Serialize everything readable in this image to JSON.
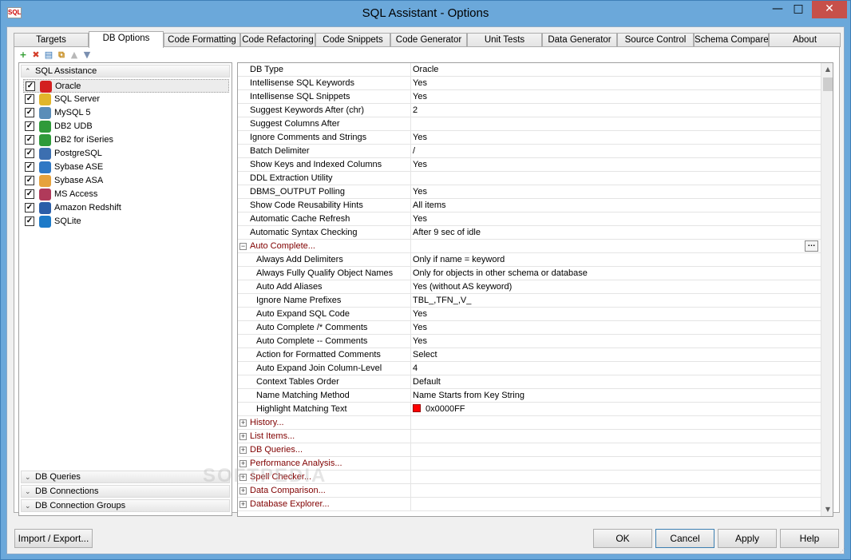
{
  "window": {
    "title": "SQL Assistant - Options",
    "icon_text": "SQL",
    "min": "—",
    "max": "□",
    "close": "✕"
  },
  "tabs": [
    "Targets",
    "DB Options",
    "Code Formatting",
    "Code Refactoring",
    "Code Snippets",
    "Code Generator",
    "Unit Tests",
    "Data Generator",
    "Source Control",
    "Schema Compare",
    "About"
  ],
  "active_tab": "DB Options",
  "toolbar": {
    "icons": [
      "add-icon",
      "delete-icon",
      "rename-icon",
      "copy-icon",
      "move-up-icon",
      "move-down-icon"
    ]
  },
  "left_panel": {
    "sql_assistance": "SQL Assistance",
    "databases": [
      {
        "label": "Oracle",
        "checked": true,
        "icon": "oracle-icon",
        "color": "#d32020"
      },
      {
        "label": "SQL Server",
        "checked": true,
        "icon": "sqlserver-icon",
        "color": "#e2b62a"
      },
      {
        "label": "MySQL 5",
        "checked": true,
        "icon": "mysql-icon",
        "color": "#5b8db8"
      },
      {
        "label": "DB2 UDB",
        "checked": true,
        "icon": "db2-icon",
        "color": "#2f9a3a"
      },
      {
        "label": "DB2 for iSeries",
        "checked": true,
        "icon": "db2-iseries-icon",
        "color": "#2f9a3a"
      },
      {
        "label": "PostgreSQL",
        "checked": true,
        "icon": "postgresql-icon",
        "color": "#3c6fb0"
      },
      {
        "label": "Sybase ASE",
        "checked": true,
        "icon": "sybase-ase-icon",
        "color": "#2f78c4"
      },
      {
        "label": "Sybase ASA",
        "checked": true,
        "icon": "sybase-asa-icon",
        "color": "#e6a23c"
      },
      {
        "label": "MS Access",
        "checked": true,
        "icon": "msaccess-icon",
        "color": "#b03a5a"
      },
      {
        "label": "Amazon Redshift",
        "checked": true,
        "icon": "redshift-icon",
        "color": "#2b5ea8"
      },
      {
        "label": "SQLite",
        "checked": true,
        "icon": "sqlite-icon",
        "color": "#1d7ac8"
      }
    ],
    "db_queries": "DB Queries",
    "db_connections": "DB Connections",
    "db_connection_groups": "DB Connection Groups"
  },
  "properties": [
    {
      "key": "DB Type",
      "value": "Oracle"
    },
    {
      "key": "Intellisense SQL Keywords",
      "value": "Yes"
    },
    {
      "key": "Intellisense SQL Snippets",
      "value": "Yes"
    },
    {
      "key": "Suggest Keywords After (chr)",
      "value": "2"
    },
    {
      "key": "Suggest Columns After",
      "value": ""
    },
    {
      "key": "Ignore Comments and Strings",
      "value": "Yes"
    },
    {
      "key": "Batch Delimiter",
      "value": "/"
    },
    {
      "key": "Show Keys and Indexed Columns",
      "value": "Yes"
    },
    {
      "key": "DDL Extraction Utility",
      "value": ""
    },
    {
      "key": "DBMS_OUTPUT Polling",
      "value": "Yes"
    },
    {
      "key": "Show Code Reusability Hints",
      "value": "All items"
    },
    {
      "key": "Automatic Cache Refresh",
      "value": "Yes"
    },
    {
      "key": "Automatic Syntax Checking",
      "value": "After 9 sec of idle"
    }
  ],
  "auto_complete": {
    "label": "Auto Complete...",
    "ellipsis": "…",
    "items": [
      {
        "key": "Always Add Delimiters",
        "value": "Only if name = keyword"
      },
      {
        "key": "Always Fully Qualify Object Names",
        "value": "Only for objects in other schema or database"
      },
      {
        "key": "Auto Add Aliases",
        "value": "Yes (without AS keyword)"
      },
      {
        "key": "Ignore Name Prefixes",
        "value": "TBL_,TFN_,V_"
      },
      {
        "key": "Auto Expand SQL Code",
        "value": "Yes"
      },
      {
        "key": "Auto Complete /* Comments",
        "value": "Yes"
      },
      {
        "key": "Auto Complete -- Comments",
        "value": "Yes"
      },
      {
        "key": "Action for Formatted Comments",
        "value": "Select"
      },
      {
        "key": "Auto Expand Join Column-Level",
        "value": "4"
      },
      {
        "key": "Context Tables Order",
        "value": "Default"
      },
      {
        "key": "Name Matching Method",
        "value": "Name Starts from Key String"
      },
      {
        "key": "Highlight Matching Text",
        "value": "0x0000FF",
        "swatch": "#ff0000"
      }
    ]
  },
  "collapsed_sections": [
    "History...",
    "List Items...",
    "DB Queries...",
    "Performance Analysis...",
    "Spell Checker...",
    "Data Comparison...",
    "Database Explorer..."
  ],
  "buttons": {
    "import_export": "Import / Export...",
    "ok": "OK",
    "cancel": "Cancel",
    "apply": "Apply",
    "help": "Help"
  },
  "watermark": "SOFTPEDIA"
}
